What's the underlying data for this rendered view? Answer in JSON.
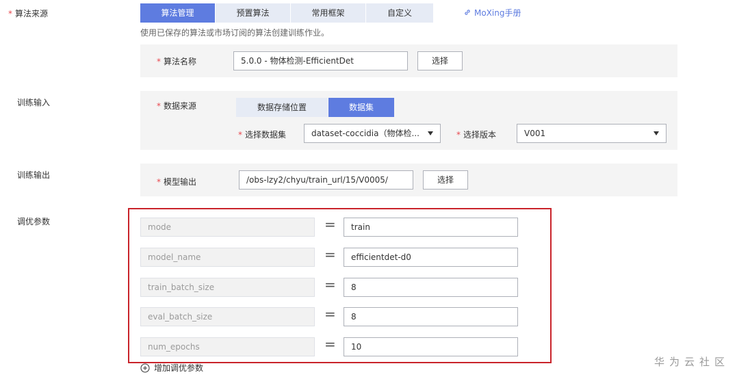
{
  "algorithm_source": {
    "label": "算法来源",
    "tabs": [
      "算法管理",
      "预置算法",
      "常用框架",
      "自定义"
    ],
    "active_tab": "算法管理",
    "moxing_link": "MoXing手册",
    "hint": "使用已保存的算法或市场订阅的算法创建训练作业。",
    "algorithm_name_label": "算法名称",
    "algorithm_name_value": "5.0.0 - 物体检测-EfficientDet",
    "select_button": "选择"
  },
  "training_input": {
    "label": "训练输入",
    "data_source_label": "数据来源",
    "source_tabs": [
      "数据存储位置",
      "数据集"
    ],
    "active_source_tab": "数据集",
    "dataset_label": "选择数据集",
    "dataset_value": "dataset-coccidia（物体检...",
    "version_label": "选择版本",
    "version_value": "V001"
  },
  "training_output": {
    "label": "训练输出",
    "model_output_label": "模型输出",
    "model_output_value": "/obs-lzy2/chyu/train_url/15/V0005/",
    "select_button": "选择"
  },
  "tuning": {
    "label": "调优参数",
    "equals_sign": "=",
    "params": [
      {
        "key": "mode",
        "value": "train"
      },
      {
        "key": "model_name",
        "value": "efficientdet-d0"
      },
      {
        "key": "train_batch_size",
        "value": "8"
      },
      {
        "key": "eval_batch_size",
        "value": "8"
      },
      {
        "key": "num_epochs",
        "value": "10"
      }
    ],
    "add_param_label": "增加调优参数"
  },
  "watermark": "华为云社区",
  "required_mark": "*",
  "colors": {
    "primary": "#5e7ce0",
    "tab_inactive": "#e6ebf5",
    "required": "#e8484f",
    "highlight": "#c9232a",
    "panel": "#f4f4f4"
  }
}
